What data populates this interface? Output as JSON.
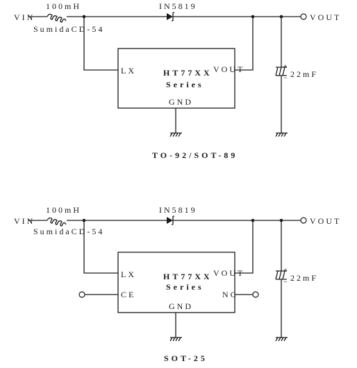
{
  "circuits": [
    {
      "id": "to92",
      "caption": "TO-92/SOT-89",
      "input_label": "VIN",
      "inductor_value": "100mH",
      "inductor_part": "SumidaCD-54",
      "diode_label": "IN5819",
      "output_label": "VOUT",
      "capacitor_value": "22mF",
      "cap_plus": "+",
      "cap_minus": "−",
      "ic_name": "HT77XX",
      "ic_series": "Series",
      "pins": {
        "lx": "LX",
        "vout": "VOUT",
        "gnd": "GND"
      }
    },
    {
      "id": "sot25",
      "caption": "SOT-25",
      "input_label": "VIN",
      "inductor_value": "100mH",
      "inductor_part": "SumidaCD-54",
      "diode_label": "IN5819",
      "output_label": "VOUT",
      "capacitor_value": "22mF",
      "cap_plus": "+",
      "cap_minus": "−",
      "ic_name": "HT77XX",
      "ic_series": "Series",
      "pins": {
        "lx": "LX",
        "vout": "VOUT",
        "gnd": "GND",
        "ce": "CE",
        "nc": "NC"
      }
    }
  ]
}
